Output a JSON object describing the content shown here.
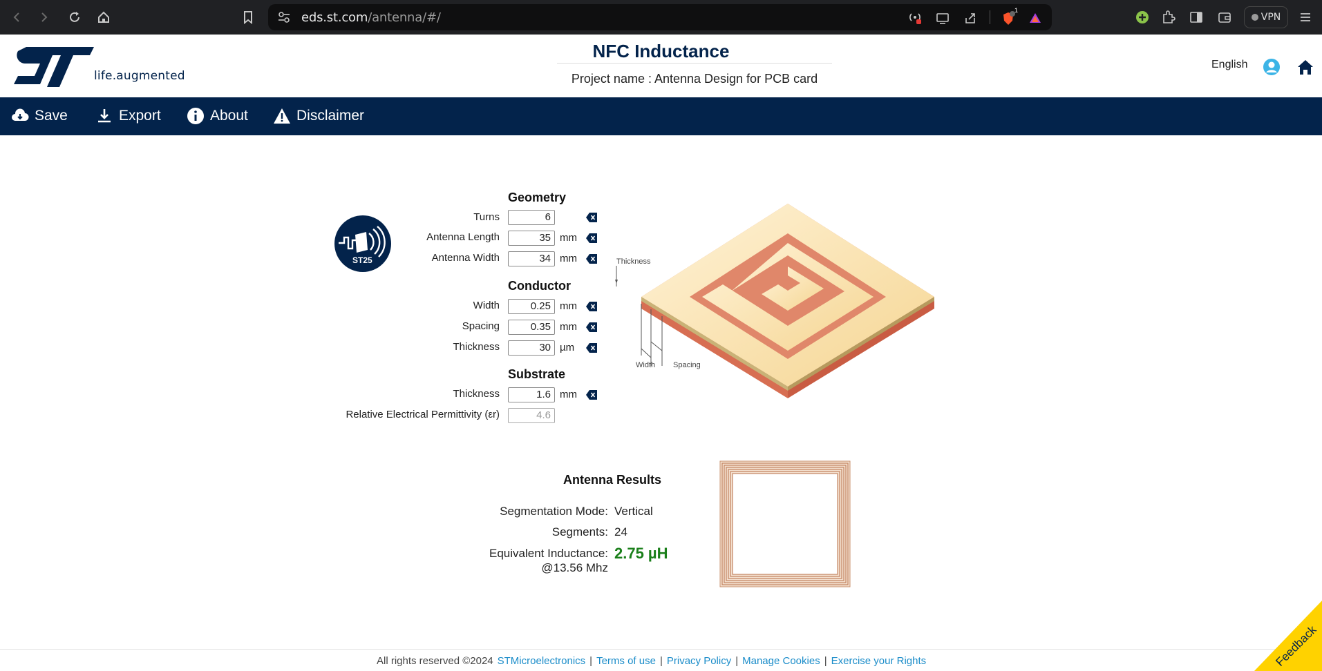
{
  "browser": {
    "url_host": "eds.st.com",
    "url_path": "/antenna/#/",
    "vpn_label": "VPN",
    "shield_badge": "1"
  },
  "header": {
    "logo_tagline": "life.augmented",
    "title": "NFC Inductance",
    "project_name": "Project name : Antenna Design for PCB card",
    "language": "English"
  },
  "toolbar": {
    "save": "Save",
    "export": "Export",
    "about": "About",
    "disclaimer": "Disclaimer"
  },
  "badge": {
    "label": "ST25"
  },
  "geometry": {
    "title": "Geometry",
    "turns": {
      "label": "Turns",
      "value": "6"
    },
    "length": {
      "label": "Antenna Length",
      "value": "35",
      "unit": "mm"
    },
    "width": {
      "label": "Antenna Width",
      "value": "34",
      "unit": "mm"
    }
  },
  "conductor": {
    "title": "Conductor",
    "width": {
      "label": "Width",
      "value": "0.25",
      "unit": "mm"
    },
    "spacing": {
      "label": "Spacing",
      "value": "0.35",
      "unit": "mm"
    },
    "thickness": {
      "label": "Thickness",
      "value": "30",
      "unit": "µm"
    }
  },
  "substrate": {
    "title": "Substrate",
    "thickness": {
      "label": "Thickness",
      "value": "1.6",
      "unit": "mm"
    },
    "permittivity": {
      "label": "Relative Electrical Permittivity (εr)",
      "value": "4.6"
    }
  },
  "diagram": {
    "thickness_label": "Thickness",
    "width_label": "Width",
    "spacing_label": "Spacing"
  },
  "results": {
    "title": "Antenna Results",
    "segmentation_label": "Segmentation Mode:",
    "segmentation_value": "Vertical",
    "segments_label": "Segments:",
    "segments_value": "24",
    "inductance_label": "Equivalent Inductance:",
    "inductance_sub": "@13.56 Mhz",
    "inductance_value": "2.75 µH"
  },
  "footer": {
    "copyright": "All rights reserved ©2024",
    "company": "STMicroelectronics",
    "terms": "Terms of use",
    "privacy": "Privacy Policy",
    "cookies": "Manage Cookies",
    "rights": "Exercise your Rights",
    "separator": "|"
  },
  "feedback": {
    "label": "Feedback"
  },
  "colors": {
    "brand_navy": "#03234b",
    "result_green": "#1a7f1a",
    "link_blue": "#1a8cc9",
    "feedback_yellow": "#ffd200"
  }
}
